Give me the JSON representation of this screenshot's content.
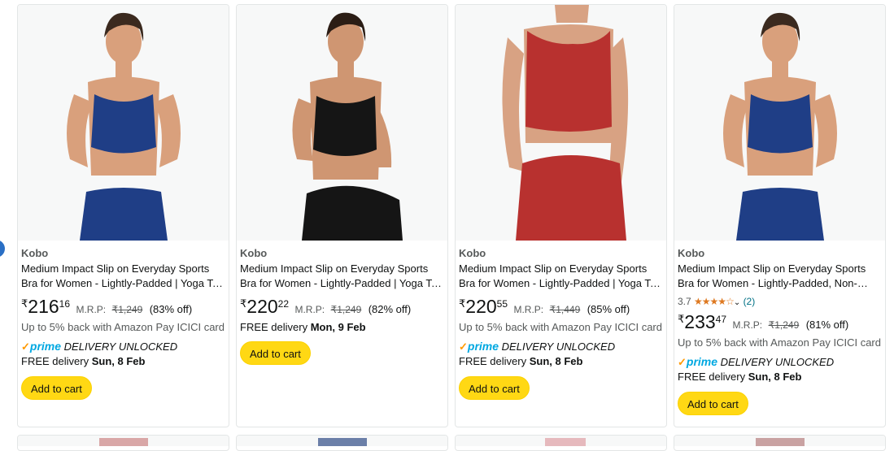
{
  "products": [
    {
      "brand": "Kobo",
      "title": "Medium Impact Slip on Everyday Sports Bra for Women - Lightly-Padded | Yoga Top | Gym Wear",
      "currency_symbol": "₹",
      "price_whole": "216",
      "price_fraction": "16",
      "mrp_label": "M.R.P:",
      "mrp": "₹1,249",
      "discount": "(83% off)",
      "cashback": "Up to 5% back with Amazon Pay ICICI card",
      "prime_label": "prime",
      "prime_text": "DELIVERY UNLOCKED",
      "delivery_prefix": "FREE delivery",
      "delivery_date": "Sun, 8 Feb",
      "button": "Add to cart",
      "garment_color": "#1f3e86"
    },
    {
      "brand": "Kobo",
      "title": "Medium Impact Slip on Everyday Sports Bra for Women - Lightly-Padded | Yoga Top | Gym Wear",
      "currency_symbol": "₹",
      "price_whole": "220",
      "price_fraction": "22",
      "mrp_label": "M.R.P:",
      "mrp": "₹1,249",
      "discount": "(82% off)",
      "delivery_prefix": "FREE delivery",
      "delivery_date": "Mon, 9 Feb",
      "button": "Add to cart",
      "garment_color": "#151515"
    },
    {
      "brand": "Kobo",
      "title": "Medium Impact Slip on Everyday Sports Bra for Women - Lightly-Padded | Yoga Top | Gym Wear",
      "currency_symbol": "₹",
      "price_whole": "220",
      "price_fraction": "55",
      "mrp_label": "M.R.P:",
      "mrp": "₹1,449",
      "discount": "(85% off)",
      "cashback": "Up to 5% back with Amazon Pay ICICI card",
      "prime_label": "prime",
      "prime_text": "DELIVERY UNLOCKED",
      "delivery_prefix": "FREE delivery",
      "delivery_date": "Sun, 8 Feb",
      "button": "Add to cart",
      "garment_color": "#b8312f"
    },
    {
      "brand": "Kobo",
      "title": "Medium Impact Slip on Everyday Sports Bra for Women - Lightly-Padded, Non-Wired Gym Top",
      "rating_value": "3.7",
      "rating_stars": "★★★★☆",
      "rating_count": "(2)",
      "currency_symbol": "₹",
      "price_whole": "233",
      "price_fraction": "47",
      "mrp_label": "M.R.P:",
      "mrp": "₹1,249",
      "discount": "(81% off)",
      "cashback": "Up to 5% back with Amazon Pay ICICI card",
      "prime_label": "prime",
      "prime_text": "DELIVERY UNLOCKED",
      "delivery_prefix": "FREE delivery",
      "delivery_date": "Sun, 8 Feb",
      "button": "Add to cart",
      "garment_color": "#1f3e86"
    }
  ],
  "colors": {
    "button_bg": "#ffd814",
    "prime_blue": "#00a8e1",
    "prime_check": "#ff9900",
    "star": "#de7921",
    "link": "#007185"
  }
}
